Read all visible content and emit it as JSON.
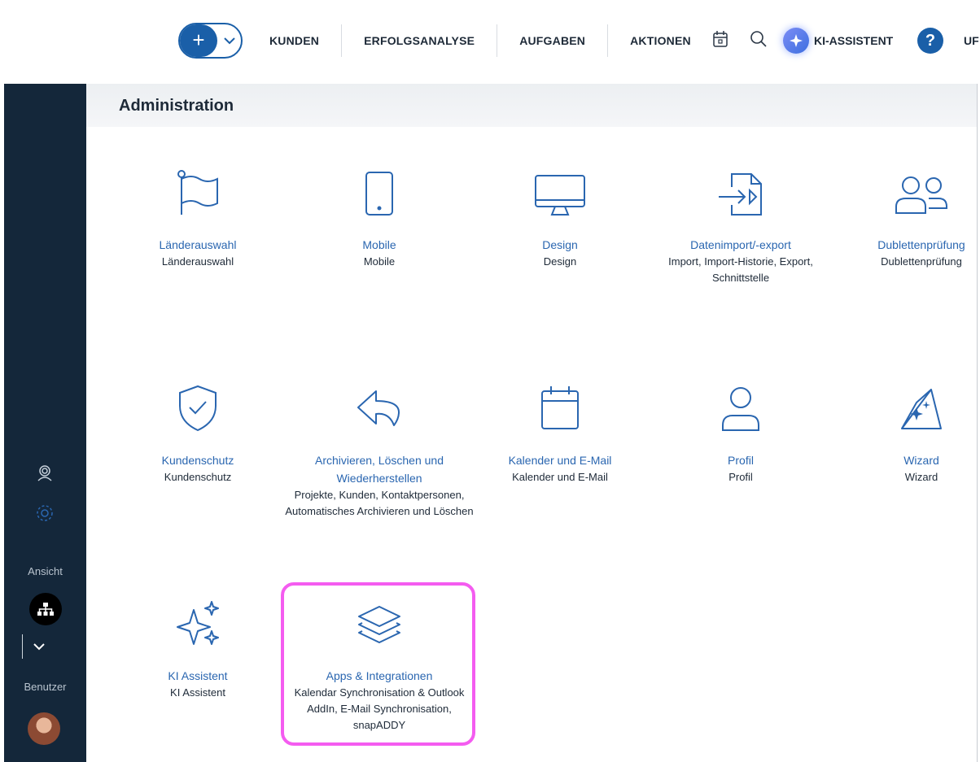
{
  "topbar": {
    "add_symbol": "+",
    "nav": [
      "KUNDEN",
      "ERFOLGSANALYSE",
      "AUFGABEN",
      "AKTIONEN"
    ],
    "ki_label": "KI-ASSISTENT",
    "help_symbol": "?",
    "user_partial": "UF"
  },
  "sidebar": {
    "ansicht_label": "Ansicht",
    "benutzer_label": "Benutzer"
  },
  "page": {
    "title": "Administration"
  },
  "tiles": [
    {
      "title": "Länderauswahl",
      "desc": "Länderauswahl"
    },
    {
      "title": "Mobile",
      "desc": "Mobile"
    },
    {
      "title": "Design",
      "desc": "Design"
    },
    {
      "title": "Datenimport/-export",
      "desc": "Import, Import-Historie, Export, Schnittstelle"
    },
    {
      "title": "Dublettenprüfung",
      "desc": "Dublettenprüfung"
    },
    {
      "title": "Kundenschutz",
      "desc": "Kundenschutz"
    },
    {
      "title": "Archivieren, Löschen und Wiederherstellen",
      "desc": "Projekte, Kunden, Kontaktpersonen, Automatisches Archivieren und Löschen"
    },
    {
      "title": "Kalender und E-Mail",
      "desc": "Kalender und E-Mail"
    },
    {
      "title": "Profil",
      "desc": "Profil"
    },
    {
      "title": "Wizard",
      "desc": "Wizard"
    },
    {
      "title": "KI Assistent",
      "desc": "KI Assistent"
    },
    {
      "title": "Apps & Integrationen",
      "desc": "Kalendar Synchronisation & Outlook AddIn, E-Mail Synchronisation, snapADDY"
    }
  ],
  "colors": {
    "accent": "#1a5fa8",
    "sidebar": "#14273a",
    "highlight": "#f45cf0",
    "link": "#2a66b0"
  }
}
